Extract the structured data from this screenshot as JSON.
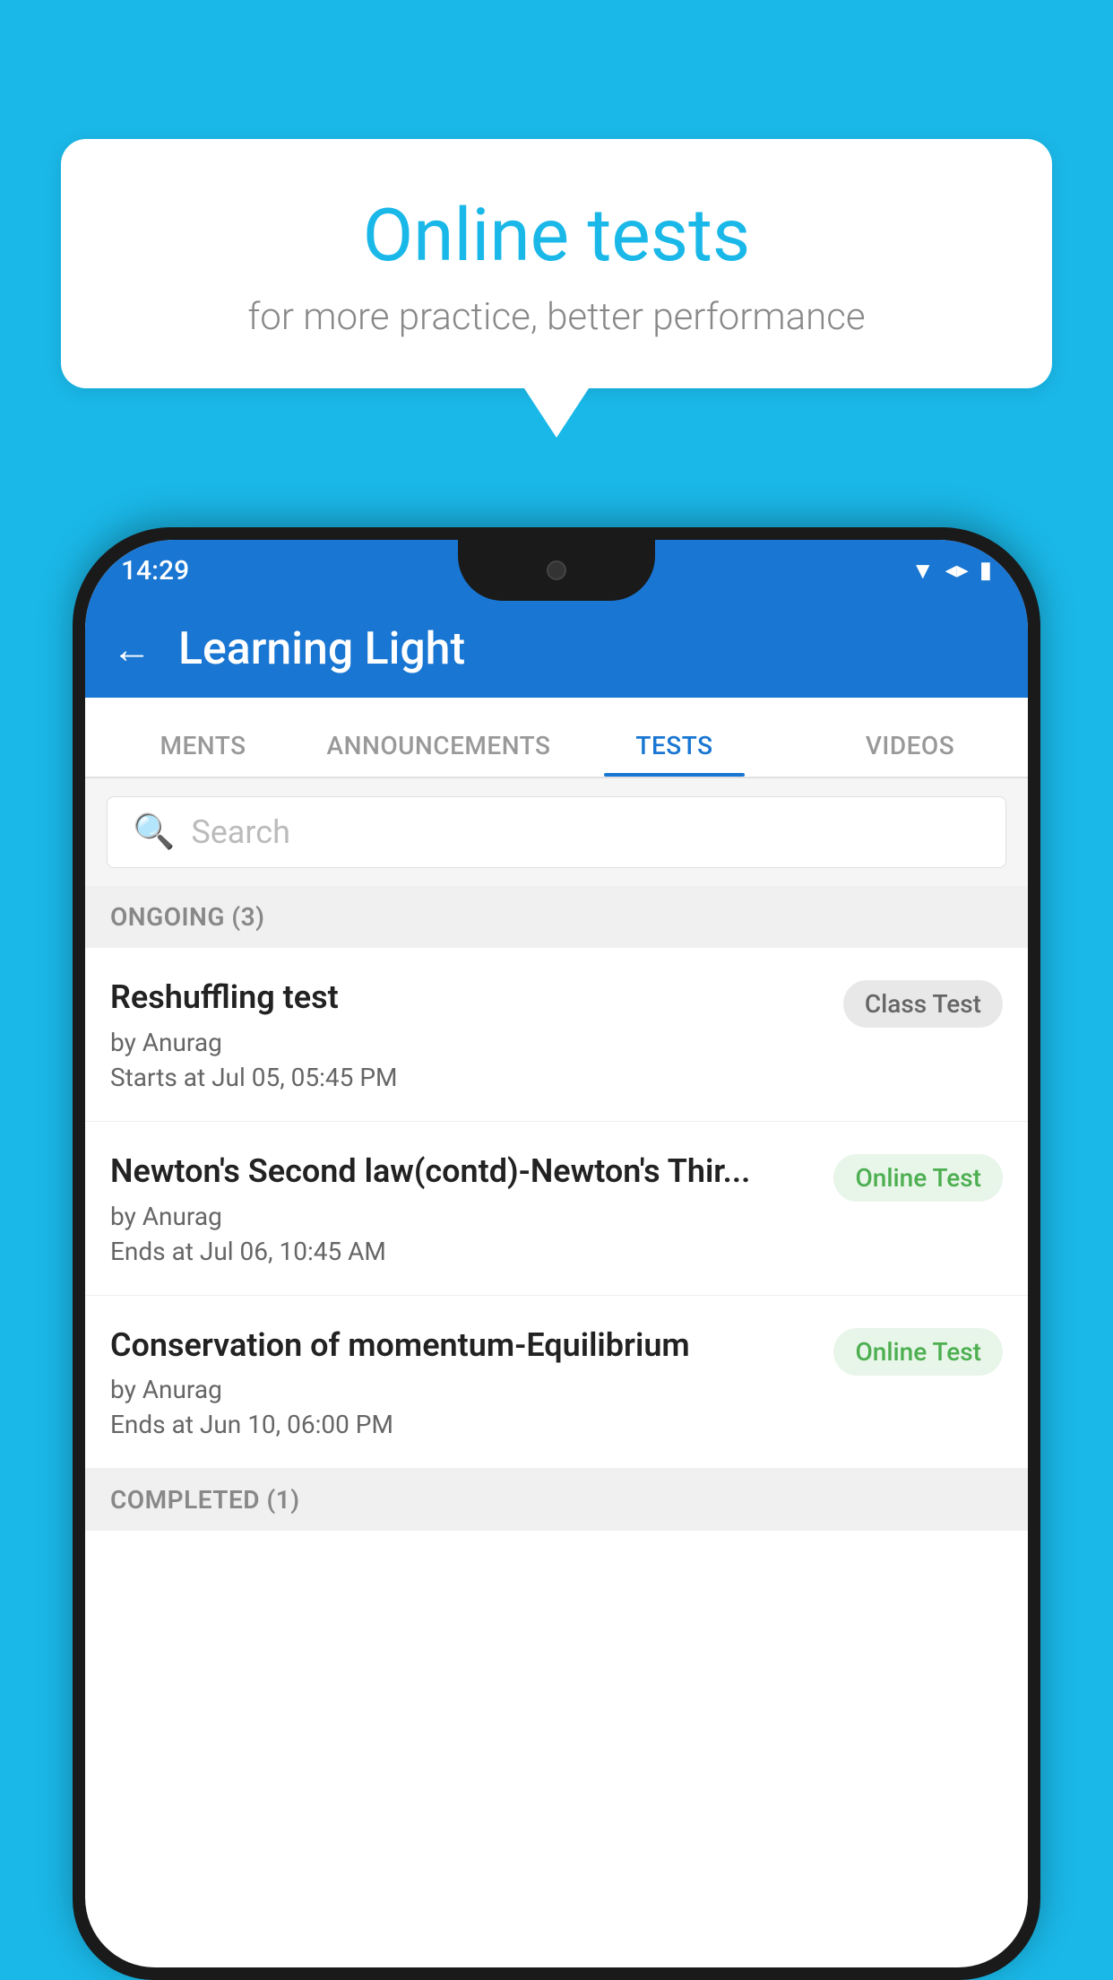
{
  "background_color": "#1ab8e8",
  "speech_bubble": {
    "title": "Online tests",
    "subtitle": "for more practice, better performance"
  },
  "phone": {
    "status_bar": {
      "time": "14:29",
      "icons": [
        "wifi",
        "signal",
        "battery"
      ]
    },
    "app_bar": {
      "title": "Learning Light",
      "back_label": "←"
    },
    "tabs": [
      {
        "label": "MENTS",
        "active": false
      },
      {
        "label": "ANNOUNCEMENTS",
        "active": false
      },
      {
        "label": "TESTS",
        "active": true
      },
      {
        "label": "VIDEOS",
        "active": false
      }
    ],
    "search": {
      "placeholder": "Search"
    },
    "ongoing_section": {
      "label": "ONGOING (3)"
    },
    "tests": [
      {
        "name": "Reshuffling test",
        "by": "by Anurag",
        "date": "Starts at  Jul 05, 05:45 PM",
        "badge": "Class Test",
        "badge_type": "class"
      },
      {
        "name": "Newton's Second law(contd)-Newton's Thir...",
        "by": "by Anurag",
        "date": "Ends at  Jul 06, 10:45 AM",
        "badge": "Online Test",
        "badge_type": "online"
      },
      {
        "name": "Conservation of momentum-Equilibrium",
        "by": "by Anurag",
        "date": "Ends at  Jun 10, 06:00 PM",
        "badge": "Online Test",
        "badge_type": "online"
      }
    ],
    "completed_section": {
      "label": "COMPLETED (1)"
    }
  }
}
